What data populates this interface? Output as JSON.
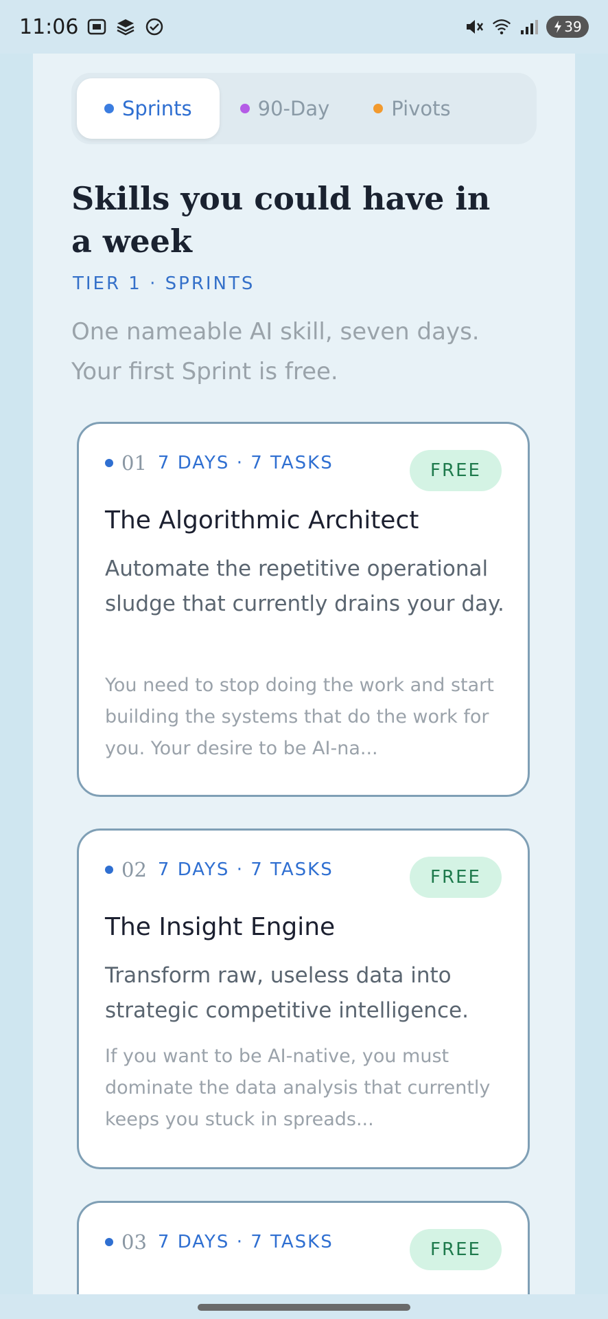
{
  "status_bar": {
    "time": "11:06",
    "battery": "39",
    "icons": [
      "screenshot-icon",
      "layers-icon",
      "check-circle-icon",
      "mute-icon",
      "wifi-icon",
      "signal-icon",
      "battery-icon"
    ]
  },
  "tabs": [
    {
      "label": "Sprints",
      "dot_color": "#3b7de0",
      "active": true
    },
    {
      "label": "90-Day",
      "dot_color": "#b45ce6",
      "active": false
    },
    {
      "label": "Pivots",
      "dot_color": "#f29a2e",
      "active": false
    }
  ],
  "heading": "Skills you could have in a week",
  "tier_label": "TIER 1 · SPRINTS",
  "subtitle": "One nameable AI skill, seven days. Your first Sprint is free.",
  "cards": [
    {
      "number": "01",
      "meta": "7 DAYS · 7 TASKS",
      "badge": "FREE",
      "title": "The Algorithmic Architect",
      "description": "Automate the repetitive operational sludge that currently drains your day.",
      "body": "You need to stop doing the work and start building the systems that do the work for you. Your desire to be AI-na..."
    },
    {
      "number": "02",
      "meta": "7 DAYS · 7 TASKS",
      "badge": "FREE",
      "title": "The Insight Engine",
      "description": "Transform raw, useless data into strategic competitive intelligence.",
      "body": "If you want to be AI-native, you must dominate the data analysis that currently keeps you stuck in spreads..."
    },
    {
      "number": "03",
      "meta": "7 DAYS · 7 TASKS",
      "badge": "FREE"
    }
  ],
  "colors": {
    "accent": "#2f6fd1",
    "badge_bg": "#d4f3e4",
    "badge_text": "#1e7a4c",
    "panel_bg": "#e8f2f7",
    "page_bg": "#cfe6f0"
  }
}
